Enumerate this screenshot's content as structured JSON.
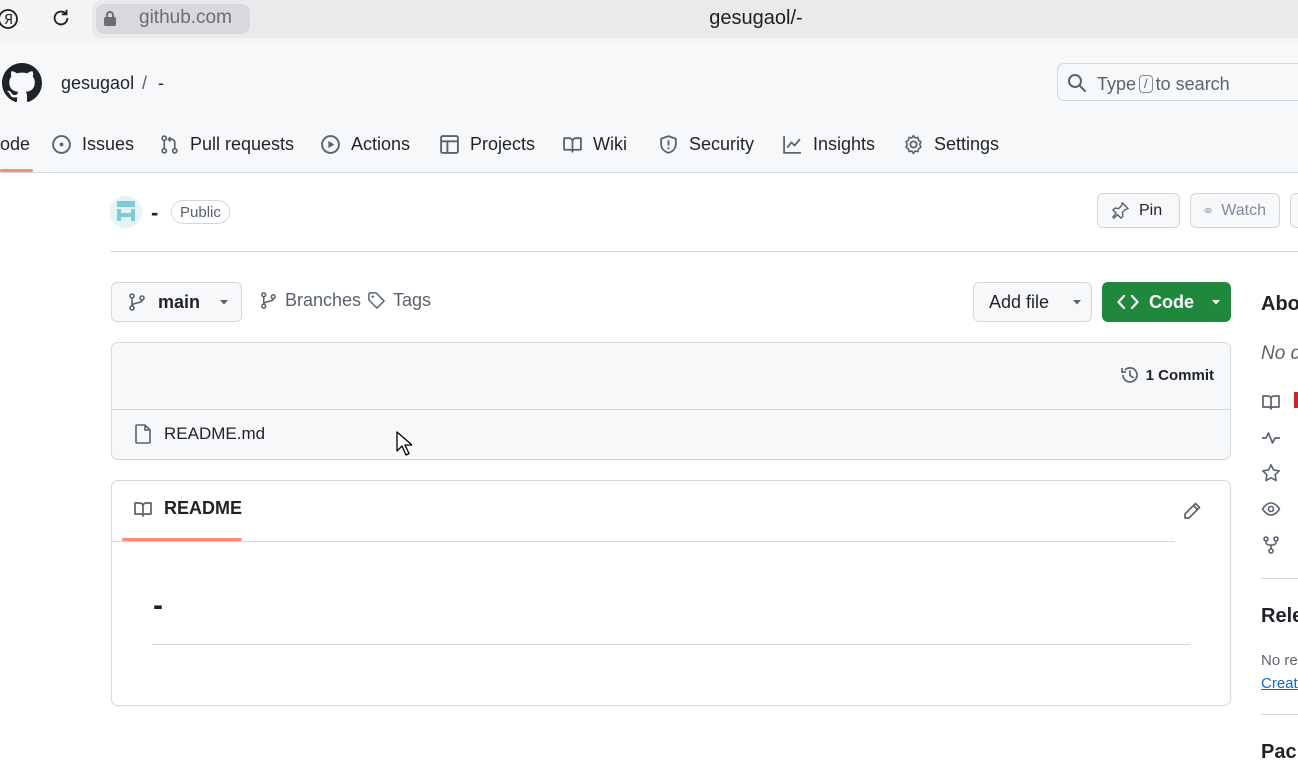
{
  "browser": {
    "host": "github.com",
    "title": "gesugaol/-"
  },
  "header": {
    "owner": "gesugaol",
    "separator": "/",
    "repo": "-",
    "search": {
      "before": "Type",
      "key": "/",
      "after": "to search"
    }
  },
  "nav": {
    "items": [
      {
        "label": "ode"
      },
      {
        "label": "Issues"
      },
      {
        "label": "Pull requests"
      },
      {
        "label": "Actions"
      },
      {
        "label": "Projects"
      },
      {
        "label": "Wiki"
      },
      {
        "label": "Security"
      },
      {
        "label": "Insights"
      },
      {
        "label": "Settings"
      }
    ]
  },
  "repo": {
    "name": "-",
    "visibility": "Public",
    "pin_label": "Pin",
    "watch_label": "Watch"
  },
  "toolbar": {
    "branch": "main",
    "branches_label": "Branches",
    "tags_label": "Tags",
    "add_file_label": "Add file",
    "code_label": "Code"
  },
  "files": {
    "commits_label": "1 Commit",
    "rows": [
      {
        "name": "README.md"
      }
    ]
  },
  "readme": {
    "tab_label": "README",
    "heading": "-"
  },
  "sidebar": {
    "about_title": "Abo",
    "about_text": "No d",
    "releases_title": "Rele",
    "releases_text": "No re",
    "releases_link": "Create",
    "packages_title": "Pack"
  },
  "colors": {
    "accent_underline": "#fd8c73",
    "code_button": "#1f883d",
    "link": "#0969da"
  }
}
